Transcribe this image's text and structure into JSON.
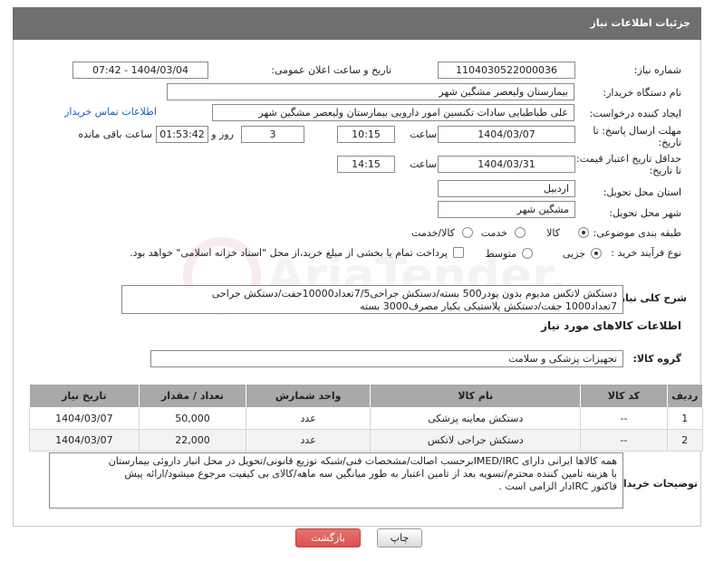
{
  "header": {
    "title": "جزئیات اطلاعات نیاز"
  },
  "form": {
    "need_number_label": "شماره نیاز:",
    "need_number": "1104030522000036",
    "announce_label": "تاریخ و ساعت اعلان عمومی:",
    "announce_value": "1404/03/04 - 07:42",
    "buyer_org_label": "نام دستگاه خریدار:",
    "buyer_org": "بیمارستان ولیعصر مشگین شهر",
    "requester_label": "ایجاد کننده درخواست:",
    "requester": "علی طباطبایی سادات تکنسین امور دارویی بیمارستان ولیعصر مشگین شهر",
    "buyer_contact_link": "اطلاعات تماس خریدار",
    "reply_deadline_label_1": "مهلت ارسال پاسخ: تا",
    "reply_deadline_label_2": "تاریخ:",
    "reply_date": "1404/03/07",
    "time_label": "ساعت",
    "reply_time": "10:15",
    "days": "3",
    "days_label": "روز و",
    "remaining": "01:53:42",
    "remaining_label": "ساعت باقی مانده",
    "price_validity_label_1": "حداقل تاریخ اعتبار قیمت:",
    "price_validity_label_2": "تا تاریخ:",
    "price_date": "1404/03/31",
    "price_time": "14:15",
    "province_label": "استان محل تحویل:",
    "province": "اردبیل",
    "city_label": "شهر محل تحویل:",
    "city": "مشگین شهر",
    "category_label": "طبقه بندی موضوعی:",
    "category_options": [
      "کالا",
      "خدمت",
      "کالا/خدمت"
    ],
    "category_selected": "کالا",
    "process_label": "نوع فرآیند خرید :",
    "process_options": [
      "جزیی",
      "متوسط"
    ],
    "process_selected": "جزیی",
    "payment_note": "پرداخت تمام یا بخشی از مبلغ خرید،از محل \"اسناد خزانه اسلامی\" خواهد بود."
  },
  "description": {
    "label": "شرح کلی نیاز:",
    "line1": "دستکش لاتکس مدیوم بدون پودر500 بسته/دستکش جراحی7/5تعداد10000جفت/دستکش جراحی",
    "line2": "7تعداد1000 جفت/دستکش پلاستیکی یکبار مصرف3000 بسته"
  },
  "goods": {
    "section_title": "اطلاعات کالاهای مورد نیاز",
    "group_label": "گروه کالا:",
    "group_value": "تجهیزات پزشکی و سلامت",
    "columns": [
      "ردیف",
      "کد کالا",
      "نام کالا",
      "واحد شمارش",
      "تعداد / مقدار",
      "تاریخ نیاز"
    ],
    "rows": [
      [
        "1",
        "--",
        "دستکش معاینه پزشکی",
        "عدد",
        "50,000",
        "1404/03/07"
      ],
      [
        "2",
        "--",
        "دستکش جراحی لاتکس",
        "عدد",
        "22,000",
        "1404/03/07"
      ]
    ]
  },
  "buyer_notes": {
    "label": "توضیحات خریدار:",
    "line1": "همه کالاها ایرانی دارای IMED/IRCبرحسب اصالت/مشخصات فنی/شبکه توزیع قانونی/تحویل در محل انبار داروئی بیمارستان",
    "line2": "با هزینه تامین کننده محترم/تسویه بعد از تامین اعتبار به طور میانگین سه ماهه/کالای بی کیفیت مرجوع میشود/ارائه پیش",
    "line3": "فاکتور IRCدار الزامی است ."
  },
  "buttons": {
    "print": "چاپ",
    "back": "بازگشت"
  },
  "colors": {
    "header_bg": "#6f6f6f",
    "back_button_bg": "#d9534f"
  }
}
